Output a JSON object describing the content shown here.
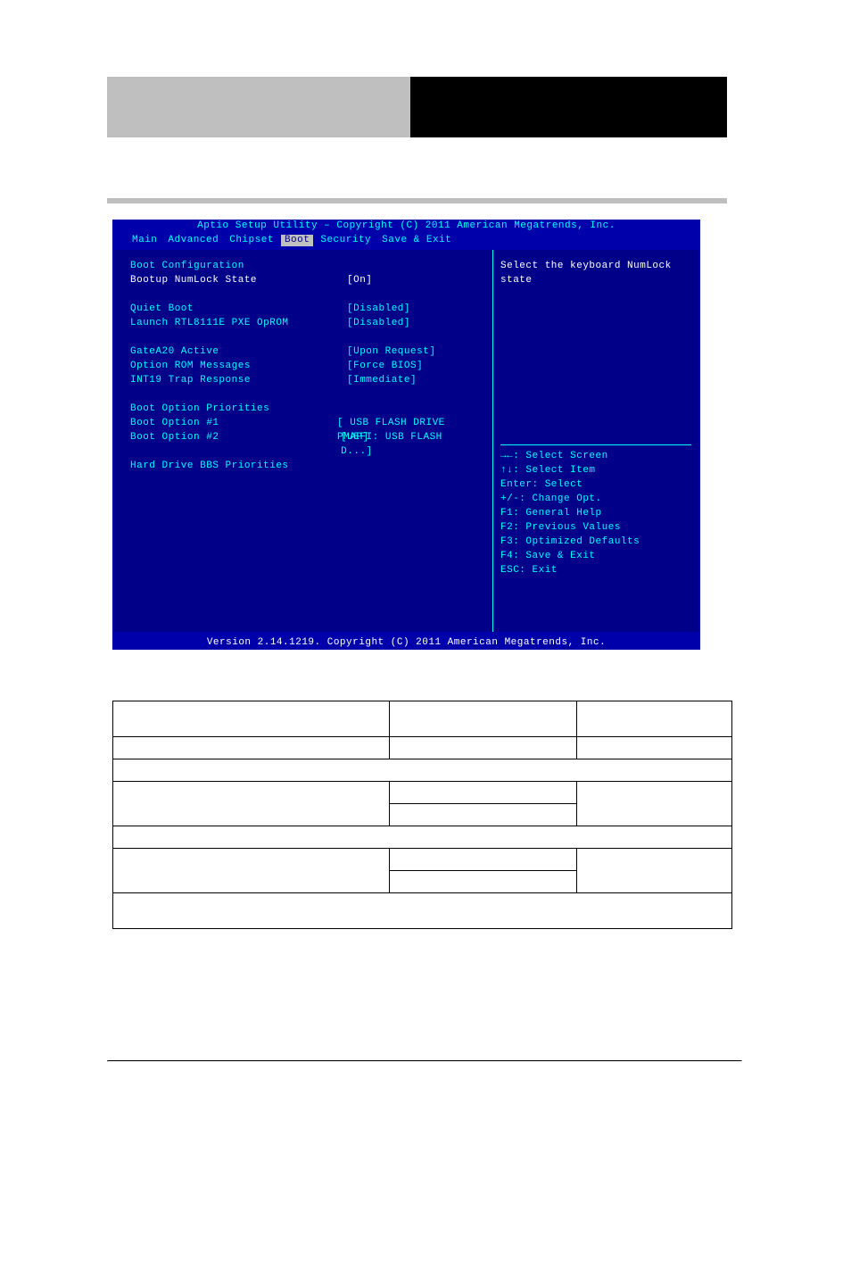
{
  "bios": {
    "title": "Aptio Setup Utility – Copyright (C) 2011 American Megatrends, Inc.",
    "menu": [
      "Main",
      "Advanced",
      "Chipset",
      "Boot",
      "Security",
      "Save & Exit"
    ],
    "active_menu_index": 3,
    "left": {
      "heading_config": "Boot Configuration",
      "rows": [
        {
          "label": "Bootup NumLock State",
          "value": "[On]",
          "white": true
        },
        {
          "blank": true
        },
        {
          "label": "Quiet Boot",
          "value": "[Disabled]"
        },
        {
          "label": "Launch RTL8111E PXE OpROM",
          "value": "[Disabled]"
        },
        {
          "blank": true
        },
        {
          "label": "GateA20 Active",
          "value": "[Upon Request]"
        },
        {
          "label": "Option ROM Messages",
          "value": "[Force BIOS]"
        },
        {
          "label": "INT19 Trap Response",
          "value": "[Immediate]"
        },
        {
          "blank": true
        }
      ],
      "heading_priorities": "Boot Option Priorities",
      "priority_rows": [
        {
          "label": "Boot Option #1",
          "value": "[ USB FLASH DRIVE PMAP]"
        },
        {
          "label": "Boot Option #2",
          "value": "[UEFI:  USB FLASH D...]"
        }
      ],
      "hdd_bbs": "Hard Drive BBS Priorities"
    },
    "right": {
      "help_text": "Select the keyboard NumLock state",
      "keys": [
        "→←: Select Screen",
        "↑↓: Select Item",
        "Enter: Select",
        "+/-: Change Opt.",
        "F1: General Help",
        "F2: Previous Values",
        "F3: Optimized Defaults",
        "F4: Save & Exit",
        "ESC: Exit"
      ]
    },
    "footer": "Version 2.14.1219. Copyright (C) 2011 American Megatrends, Inc."
  },
  "table": {
    "row1": [
      "",
      "",
      ""
    ],
    "row2": [
      "",
      "",
      ""
    ],
    "row3_span": "",
    "row4": [
      "",
      "",
      ""
    ],
    "row5_span": "",
    "row6": [
      "",
      "",
      ""
    ],
    "row7_span": ""
  }
}
